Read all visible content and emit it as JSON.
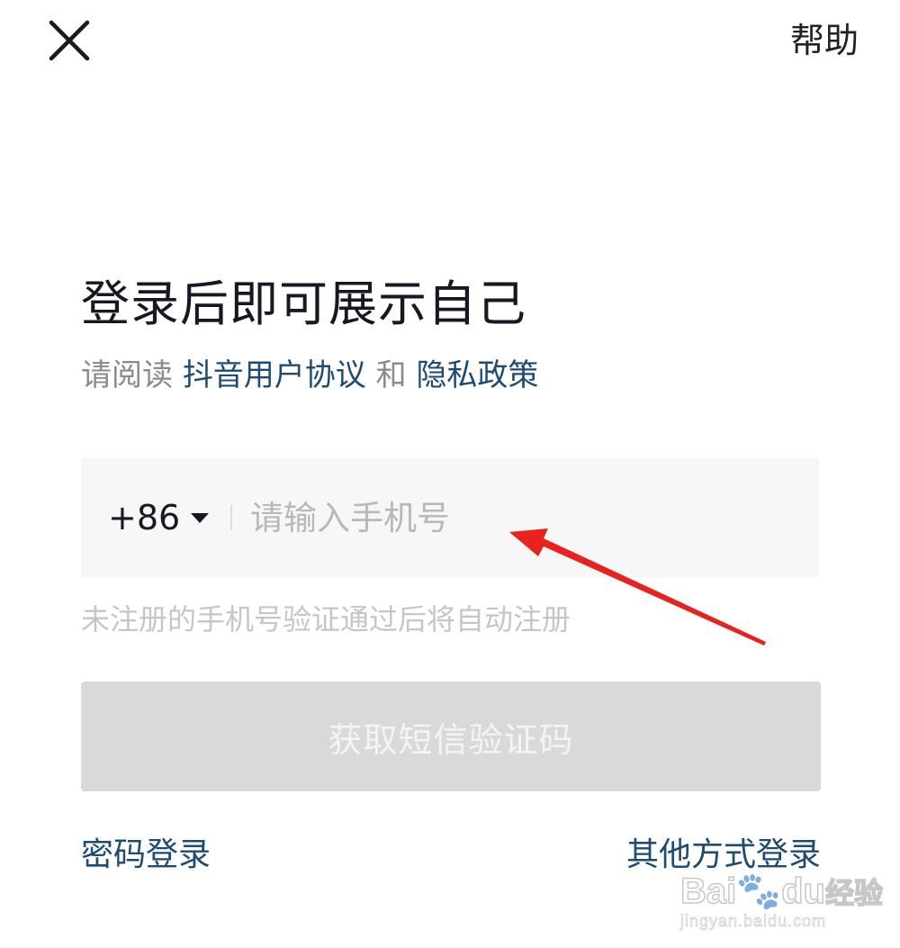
{
  "header": {
    "close_icon": "close-x-icon",
    "help_label": "帮助"
  },
  "main": {
    "title": "登录后即可展示自己",
    "agreement": {
      "prefix": "请阅读 ",
      "user_agreement": "抖音用户协议",
      "and": " 和 ",
      "privacy_policy": "隐私政策"
    },
    "phone": {
      "country_code": "+86",
      "dropdown_icon": "caret-down-icon",
      "placeholder": "请输入手机号",
      "value": ""
    },
    "hint": "未注册的手机号验证通过后将自动注册",
    "sms_button_label": "获取短信验证码",
    "password_login_label": "密码登录",
    "other_login_label": "其他方式登录"
  },
  "annotation": {
    "arrow_color": "#e8231f"
  },
  "watermark": {
    "brand_latin": "Bai",
    "brand_du": "du",
    "brand_cn": "经验",
    "url": "jingyan.baidu.com"
  },
  "colors": {
    "link": "#1e4b73",
    "button_disabled": "#d9d9db",
    "input_bg": "#f7f7f7"
  }
}
